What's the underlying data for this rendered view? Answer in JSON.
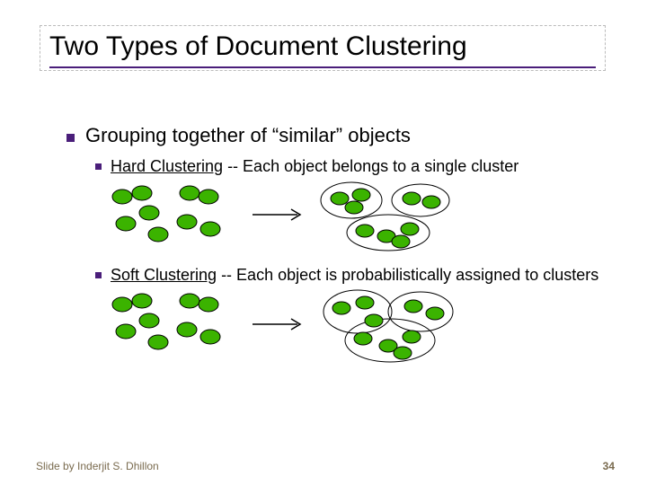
{
  "title": "Two Types of Document Clustering",
  "bullets": {
    "lvl1": "Grouping together of “similar” objects",
    "hard_label": "Hard Clustering",
    "hard_desc": " -- Each object belongs to a single cluster",
    "soft_label": "Soft Clustering",
    "soft_desc": " -- Each object is probabilistically assigned to clusters"
  },
  "footer": {
    "credit": "Slide by Inderjit S. Dhillon",
    "page": "34"
  }
}
